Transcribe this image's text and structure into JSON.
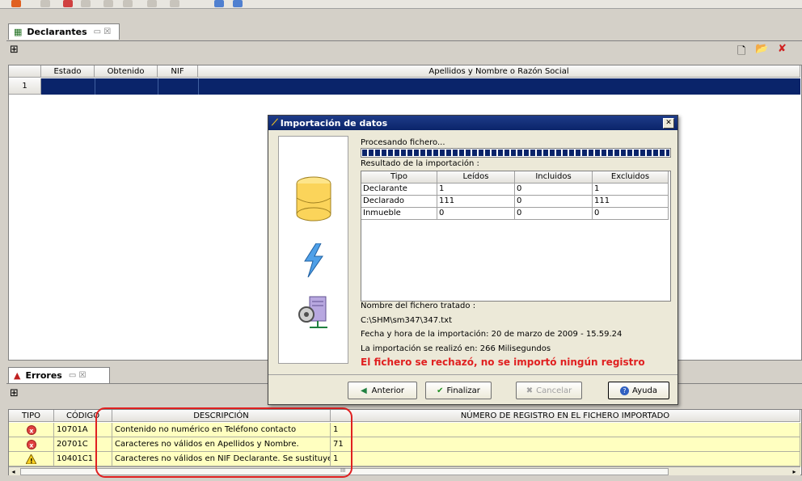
{
  "declarantes": {
    "tab_label": "Declarantes",
    "tab_icons": "▭ ☒",
    "columns": [
      "Estado",
      "Obtenido",
      "NIF",
      "Apellidos y Nombre o Razón Social"
    ],
    "rows": [
      {
        "num": "1"
      }
    ]
  },
  "dialog": {
    "title": "Importación de datos",
    "processing": "Procesando fichero...",
    "result_label": "Resultado de la importación :",
    "progress": 1.0,
    "table": {
      "headers": [
        "Tipo",
        "Leídos",
        "Incluidos",
        "Excluidos"
      ],
      "rows": [
        [
          "Declarante",
          "1",
          "0",
          "1"
        ],
        [
          "Declarado",
          "111",
          "0",
          "111"
        ],
        [
          "Inmueble",
          "0",
          "0",
          "0"
        ]
      ]
    },
    "file_label": "Nombre del fichero tratado :",
    "file_path": "C:\\SHM\\sm347\\347.txt",
    "date_line": "Fecha y hora de la importación: 20 de marzo de 2009 - 15.59.24",
    "duration_line": "La importación se realizó en: 266 Milisegundos",
    "rejected_msg": "El fichero se rechazó, no se importó ningún registro",
    "buttons": {
      "prev": "Anterior",
      "finish": "Finalizar",
      "cancel": "Cancelar",
      "help": "Ayuda"
    }
  },
  "errores": {
    "tab_label": "Errores",
    "tab_icons": "▭ ☒",
    "columns": [
      "TIPO",
      "CÓDIGO",
      "DESCRIPCIÓN",
      "NÚMERO DE REGISTRO EN EL FICHERO IMPORTADO"
    ],
    "rows": [
      {
        "type": "error",
        "code": "10701A",
        "desc": "Contenido no numérico en Teléfono contacto",
        "reg": "1"
      },
      {
        "type": "error",
        "code": "20701C",
        "desc": "Caracteres no válidos en Apellidos y Nombre.",
        "reg": "71"
      },
      {
        "type": "warning",
        "code": "10401C1",
        "desc": "Caracteres no válidos en NIF Declarante. Se sustituyen.",
        "reg": "1"
      }
    ],
    "scroll_mid": "III"
  },
  "colors": {
    "selected_row": "#0a246a",
    "error_bg": "#ffffc0",
    "highlight": "#e02020",
    "rejected_text": "#e02020"
  }
}
